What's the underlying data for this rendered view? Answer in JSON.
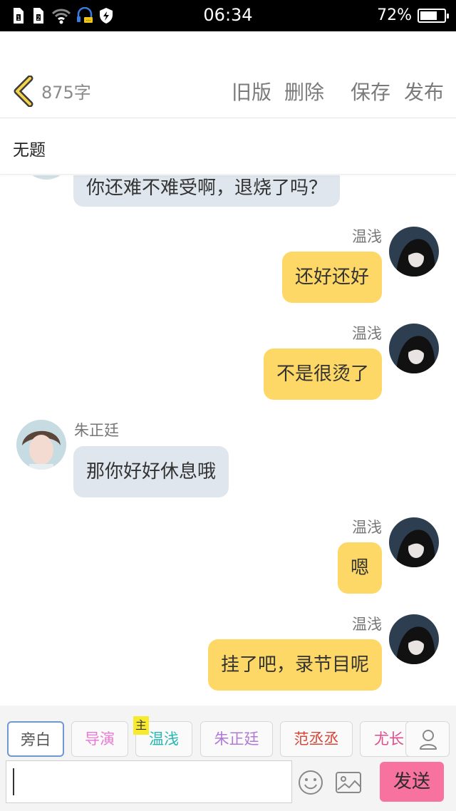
{
  "status_bar": {
    "time": "06:34",
    "battery": "72%",
    "battery_level": 0.72
  },
  "header": {
    "word_count": "875字",
    "buttons": {
      "old_version": "旧版",
      "delete": "删除",
      "save": "保存",
      "publish": "发布"
    }
  },
  "title": "无题",
  "messages": [
    {
      "side": "left",
      "text": "你还难不难受啊，退烧了吗？"
    },
    {
      "side": "right",
      "name": "温浅",
      "text": "还好还好"
    },
    {
      "side": "right",
      "name": "温浅",
      "text": "不是很烫了"
    },
    {
      "side": "left",
      "name": "朱正廷",
      "text": "那你好好休息哦"
    },
    {
      "side": "right",
      "name": "温浅",
      "text": "嗯"
    },
    {
      "side": "right",
      "name": "温浅",
      "text": "挂了吧，录节目呢"
    }
  ],
  "roles": [
    {
      "label": "旁白",
      "color": "#555555",
      "selected": true
    },
    {
      "label": "导演",
      "color": "#e77ad2"
    },
    {
      "label": "温浅",
      "color": "#26b7b2",
      "badge": "主"
    },
    {
      "label": "朱正廷",
      "color": "#b07ad6"
    },
    {
      "label": "范丞丞",
      "color": "#d6473a"
    },
    {
      "label": "尤长",
      "color": "#e04c8c"
    }
  ],
  "input": {
    "value": ""
  },
  "send_label": "发送",
  "colors": {
    "bubble_self": "#fdd866",
    "bubble_other": "#dfe6ed",
    "send": "#f7729e",
    "selected_role_border": "#6f97d6"
  }
}
